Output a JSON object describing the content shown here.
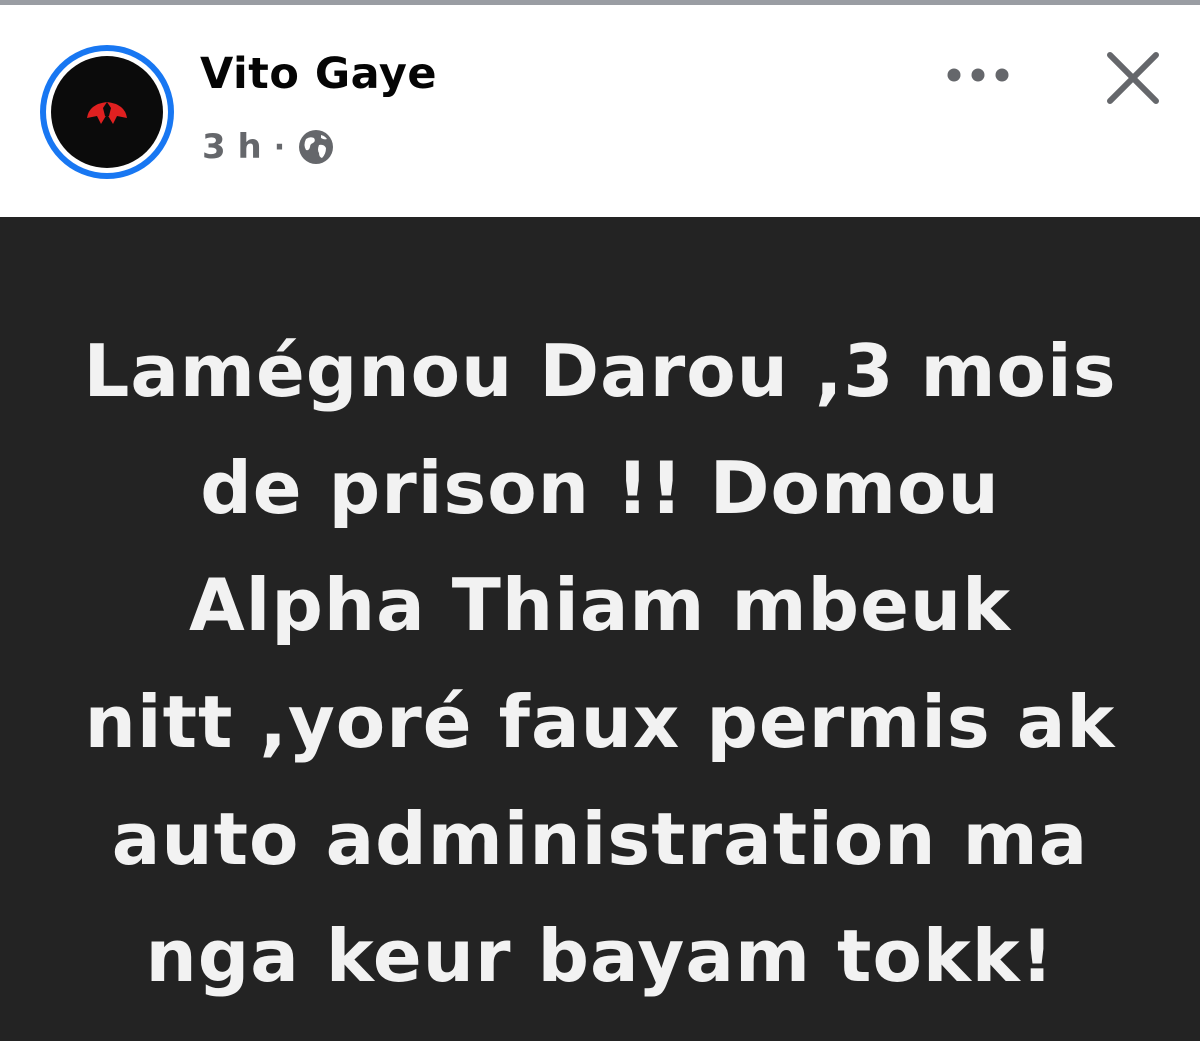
{
  "post": {
    "author": "Vito Gaye",
    "time": "3 h",
    "separator": "·",
    "audience_icon": "globe-icon",
    "text": "Lamégnou Darou ,3 mois\nde prison !! Domou\nAlpha Thiam mbeuk\nnitt ,yoré faux permis ak\nauto administration ma\nnga keur bayam tokk!"
  },
  "icons": {
    "more": "more-options-icon",
    "close": "close-icon"
  },
  "colors": {
    "avatar_ring": "#1877f2",
    "post_background": "#232323",
    "post_text": "#f2f2f2",
    "meta_text": "#65676b",
    "avatar_accent": "#e02020"
  }
}
